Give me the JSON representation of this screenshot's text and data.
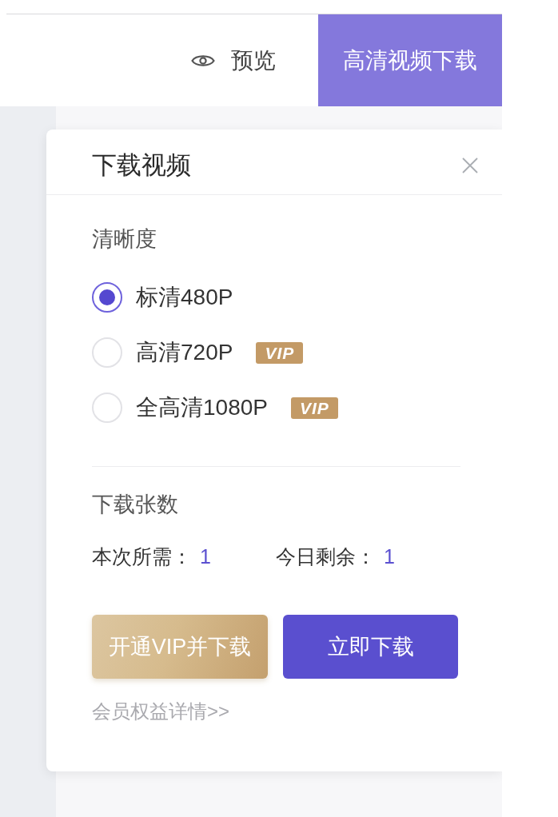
{
  "header": {
    "preview_link": {
      "label": "预览"
    },
    "download_button": {
      "label": "高清视频下载"
    }
  },
  "dialog": {
    "title": "下载视频",
    "resolution": {
      "label": "清晰度",
      "options": [
        {
          "label": "标清480P",
          "selected": true
        },
        {
          "label": "高清720P",
          "selected": false,
          "badge": "VIP"
        },
        {
          "label": "全高清1080P",
          "selected": false,
          "badge": "VIP"
        }
      ]
    },
    "count": {
      "label": "下载张数",
      "items": [
        {
          "label": "本次所需：",
          "value": "1"
        },
        {
          "label": "今日剩余：",
          "value": "1"
        }
      ]
    },
    "buttons": [
      {
        "label": "开通VIP并下载",
        "kind": "vip"
      },
      {
        "label": "立即下载",
        "kind": "primary"
      }
    ],
    "benefits_link": "会员权益详情>>"
  }
}
